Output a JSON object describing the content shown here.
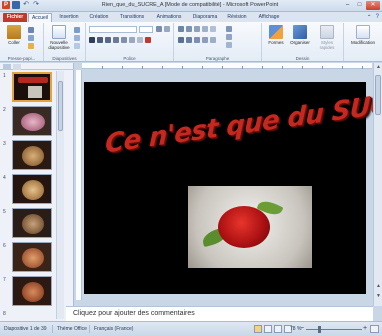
{
  "window": {
    "title": "Rien_que_du_SUCRE_A [Mode de compatibilité] - Microsoft PowerPoint",
    "minimize": "–",
    "maximize": "□",
    "close": "✕"
  },
  "qat": {
    "app": "P",
    "undo": "↶",
    "redo": "↷"
  },
  "tabs": {
    "file": "Fichier",
    "items": [
      "Accueil",
      "Insertion",
      "Création",
      "Transitions",
      "Animations",
      "Diaporama",
      "Révision",
      "Affichage"
    ],
    "active": "Accueil"
  },
  "ribbon": {
    "clipboard": {
      "paste": "Coller",
      "label": "Presse-papi..."
    },
    "slides": {
      "new_slide": "Nouvelle diapositive",
      "label": "Diapositives"
    },
    "font": {
      "label": "Police"
    },
    "paragraph": {
      "label": "Paragraphe"
    },
    "drawing": {
      "shapes": "Formes",
      "arrange": "Organiser",
      "quick_styles": "Styles rapides",
      "label": "Dessin"
    },
    "editing": {
      "modify": "Modification"
    }
  },
  "thumbnails": {
    "numbers": [
      "1",
      "2",
      "3",
      "4",
      "5",
      "6",
      "7",
      "8"
    ],
    "selected": 1
  },
  "slide": {
    "title": "Ce n'est que du SUCRE"
  },
  "notes": {
    "placeholder": "Cliquez pour ajouter des commentaires"
  },
  "status": {
    "slide_counter": "Diapositive 1 de 39",
    "theme": "Thème Office",
    "language": "Français (France)",
    "zoom": "78 %"
  }
}
